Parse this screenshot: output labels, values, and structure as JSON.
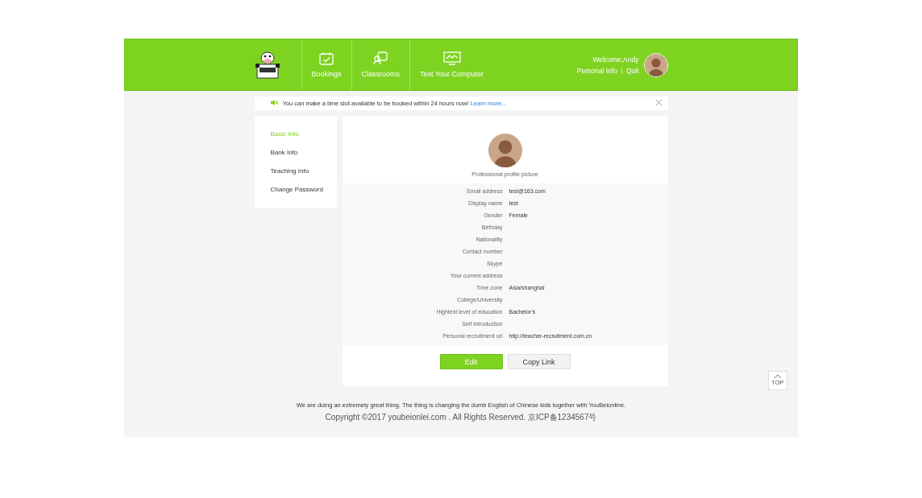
{
  "header": {
    "nav": [
      {
        "label": "Bookings",
        "kind": "bookings"
      },
      {
        "label": "Classrooms",
        "kind": "classrooms"
      },
      {
        "label": "Test Your Computer",
        "kind": "test"
      }
    ],
    "user": {
      "welcome": "Welcome,Andy",
      "links": [
        "Personal Info",
        "Quit"
      ]
    }
  },
  "notice": {
    "text": "You can make a time slot available to be booked within 24 hours now!",
    "link": "Learn more..."
  },
  "sidebar": {
    "items": [
      {
        "label": "Basic Info",
        "selected": true
      },
      {
        "label": "Bank Info",
        "selected": false
      },
      {
        "label": "Teaching Info",
        "selected": false
      },
      {
        "label": "Change Password",
        "selected": false
      }
    ]
  },
  "profile": {
    "picture_caption": "Professional profile picture",
    "fields": [
      {
        "label": "Email address",
        "value": "test@163.com"
      },
      {
        "label": "Display name",
        "value": "test"
      },
      {
        "label": "Gender",
        "value": "Female"
      },
      {
        "label": "Birthday"
      },
      {
        "label": "Nationality"
      },
      {
        "label": "Contact number"
      },
      {
        "label": "Skype"
      },
      {
        "label": "Your current address"
      },
      {
        "label": "Time zone",
        "value": "Asia/shanghai"
      },
      {
        "label": "College/University"
      },
      {
        "label": "Hightest level of education",
        "value": "Bachelor’s"
      },
      {
        "label": "Self introduction"
      },
      {
        "label": "Personal recruitment url",
        "value": "http://teacher-recruitment.com.cn"
      }
    ],
    "buttons": [
      {
        "label": "Edit",
        "kind": "primary"
      },
      {
        "label": "Copy Link",
        "kind": "secondary"
      }
    ]
  },
  "top_button": "TOP",
  "footer": {
    "lines": [
      "We are doing an extremely great thing. The thing is changing the dumb English of Chinese kids together with YouBeionline.",
      "Copyright ©2017 youbeionlei.com . All Rights Reserved. 京ICP备1234567号"
    ]
  }
}
